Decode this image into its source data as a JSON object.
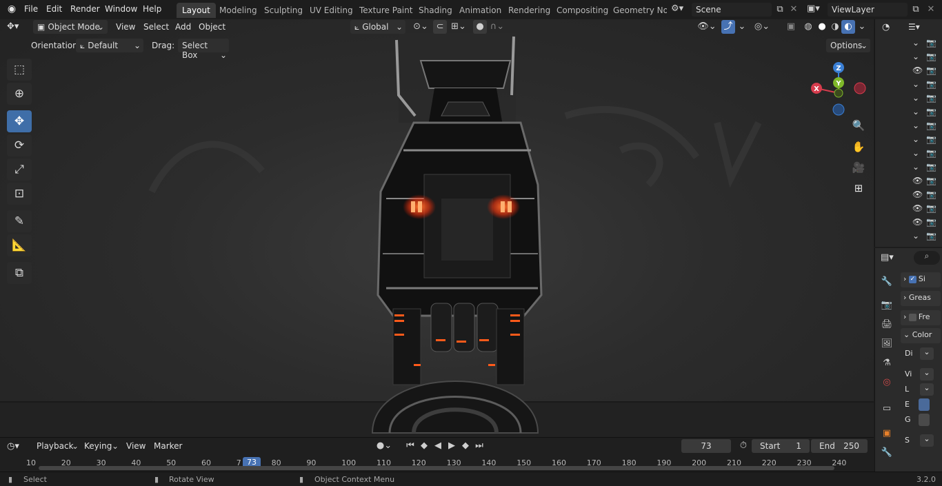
{
  "app": {
    "version": "3.2.0"
  },
  "menus": [
    "File",
    "Edit",
    "Render",
    "Window",
    "Help"
  ],
  "workspaces": [
    {
      "label": "Layout",
      "active": true
    },
    {
      "label": "Modeling",
      "active": false
    },
    {
      "label": "Sculpting",
      "active": false
    },
    {
      "label": "UV Editing",
      "active": false
    },
    {
      "label": "Texture Paint",
      "active": false
    },
    {
      "label": "Shading",
      "active": false
    },
    {
      "label": "Animation",
      "active": false
    },
    {
      "label": "Rendering",
      "active": false
    },
    {
      "label": "Compositing",
      "active": false
    },
    {
      "label": "Geometry Noc",
      "active": false
    }
  ],
  "scene": {
    "value": "Scene"
  },
  "view_layer": {
    "value": "ViewLayer"
  },
  "viewport_header": {
    "mode": "Object Mode",
    "menus": [
      "View",
      "Select",
      "Add",
      "Object"
    ],
    "transform_orientation": "Global",
    "orientation_label": "Orientation:",
    "orientation_value": "Default",
    "drag_label": "Drag:",
    "drag_value": "Select Box",
    "options_label": "Options"
  },
  "tools": [
    {
      "name": "select-box-tool",
      "glyph": "⬚",
      "active": false
    },
    {
      "name": "cursor-tool",
      "glyph": "⊕",
      "active": false
    },
    {
      "name": "move-tool",
      "glyph": "✥",
      "active": true
    },
    {
      "name": "rotate-tool",
      "glyph": "⟳",
      "active": false
    },
    {
      "name": "scale-tool",
      "glyph": "⤢",
      "active": false
    },
    {
      "name": "transform-tool",
      "glyph": "⊡",
      "active": false
    },
    {
      "name": "annotate-tool",
      "glyph": "✎",
      "active": false
    },
    {
      "name": "measure-tool",
      "glyph": "📐",
      "active": false
    },
    {
      "name": "add-cube-tool",
      "glyph": "⧉",
      "active": false
    }
  ],
  "gizmo": {
    "x": "X",
    "y": "Y",
    "z": "Z",
    "x_color": "#d63c4d",
    "y_color": "#7fb82a",
    "z_color": "#3a7fd5"
  },
  "accent_color": "#4772b3",
  "timeline": {
    "menus": [
      "Playback",
      "Keying",
      "View",
      "Marker"
    ],
    "current_frame": "73",
    "start_label": "Start",
    "start_value": "1",
    "end_label": "End",
    "end_value": "250",
    "ticks": [
      "10",
      "20",
      "30",
      "40",
      "50",
      "60",
      "7",
      "80",
      "90",
      "100",
      "110",
      "120",
      "130",
      "140",
      "150",
      "160",
      "170",
      "180",
      "190",
      "200",
      "210",
      "220",
      "230",
      "240"
    ]
  },
  "properties": {
    "rows": [
      {
        "label": "Si",
        "kind": "checkbox-checked"
      },
      {
        "label": "Greas",
        "kind": "expander"
      },
      {
        "label": "Fre",
        "kind": "checkbox"
      },
      {
        "label": "Color",
        "kind": "panel-open"
      },
      {
        "label": "Di",
        "kind": "dropdown"
      },
      {
        "label": "Vi",
        "kind": "dropdown"
      },
      {
        "label": "L",
        "kind": "dropdown"
      },
      {
        "label": "E",
        "kind": "swatch"
      },
      {
        "label": "G",
        "kind": "swatch"
      },
      {
        "label": "S",
        "kind": "dropdown"
      }
    ]
  },
  "status": {
    "select": "Select",
    "rotate": "Rotate View",
    "context": "Object Context Menu",
    "version": "3.2.0"
  }
}
